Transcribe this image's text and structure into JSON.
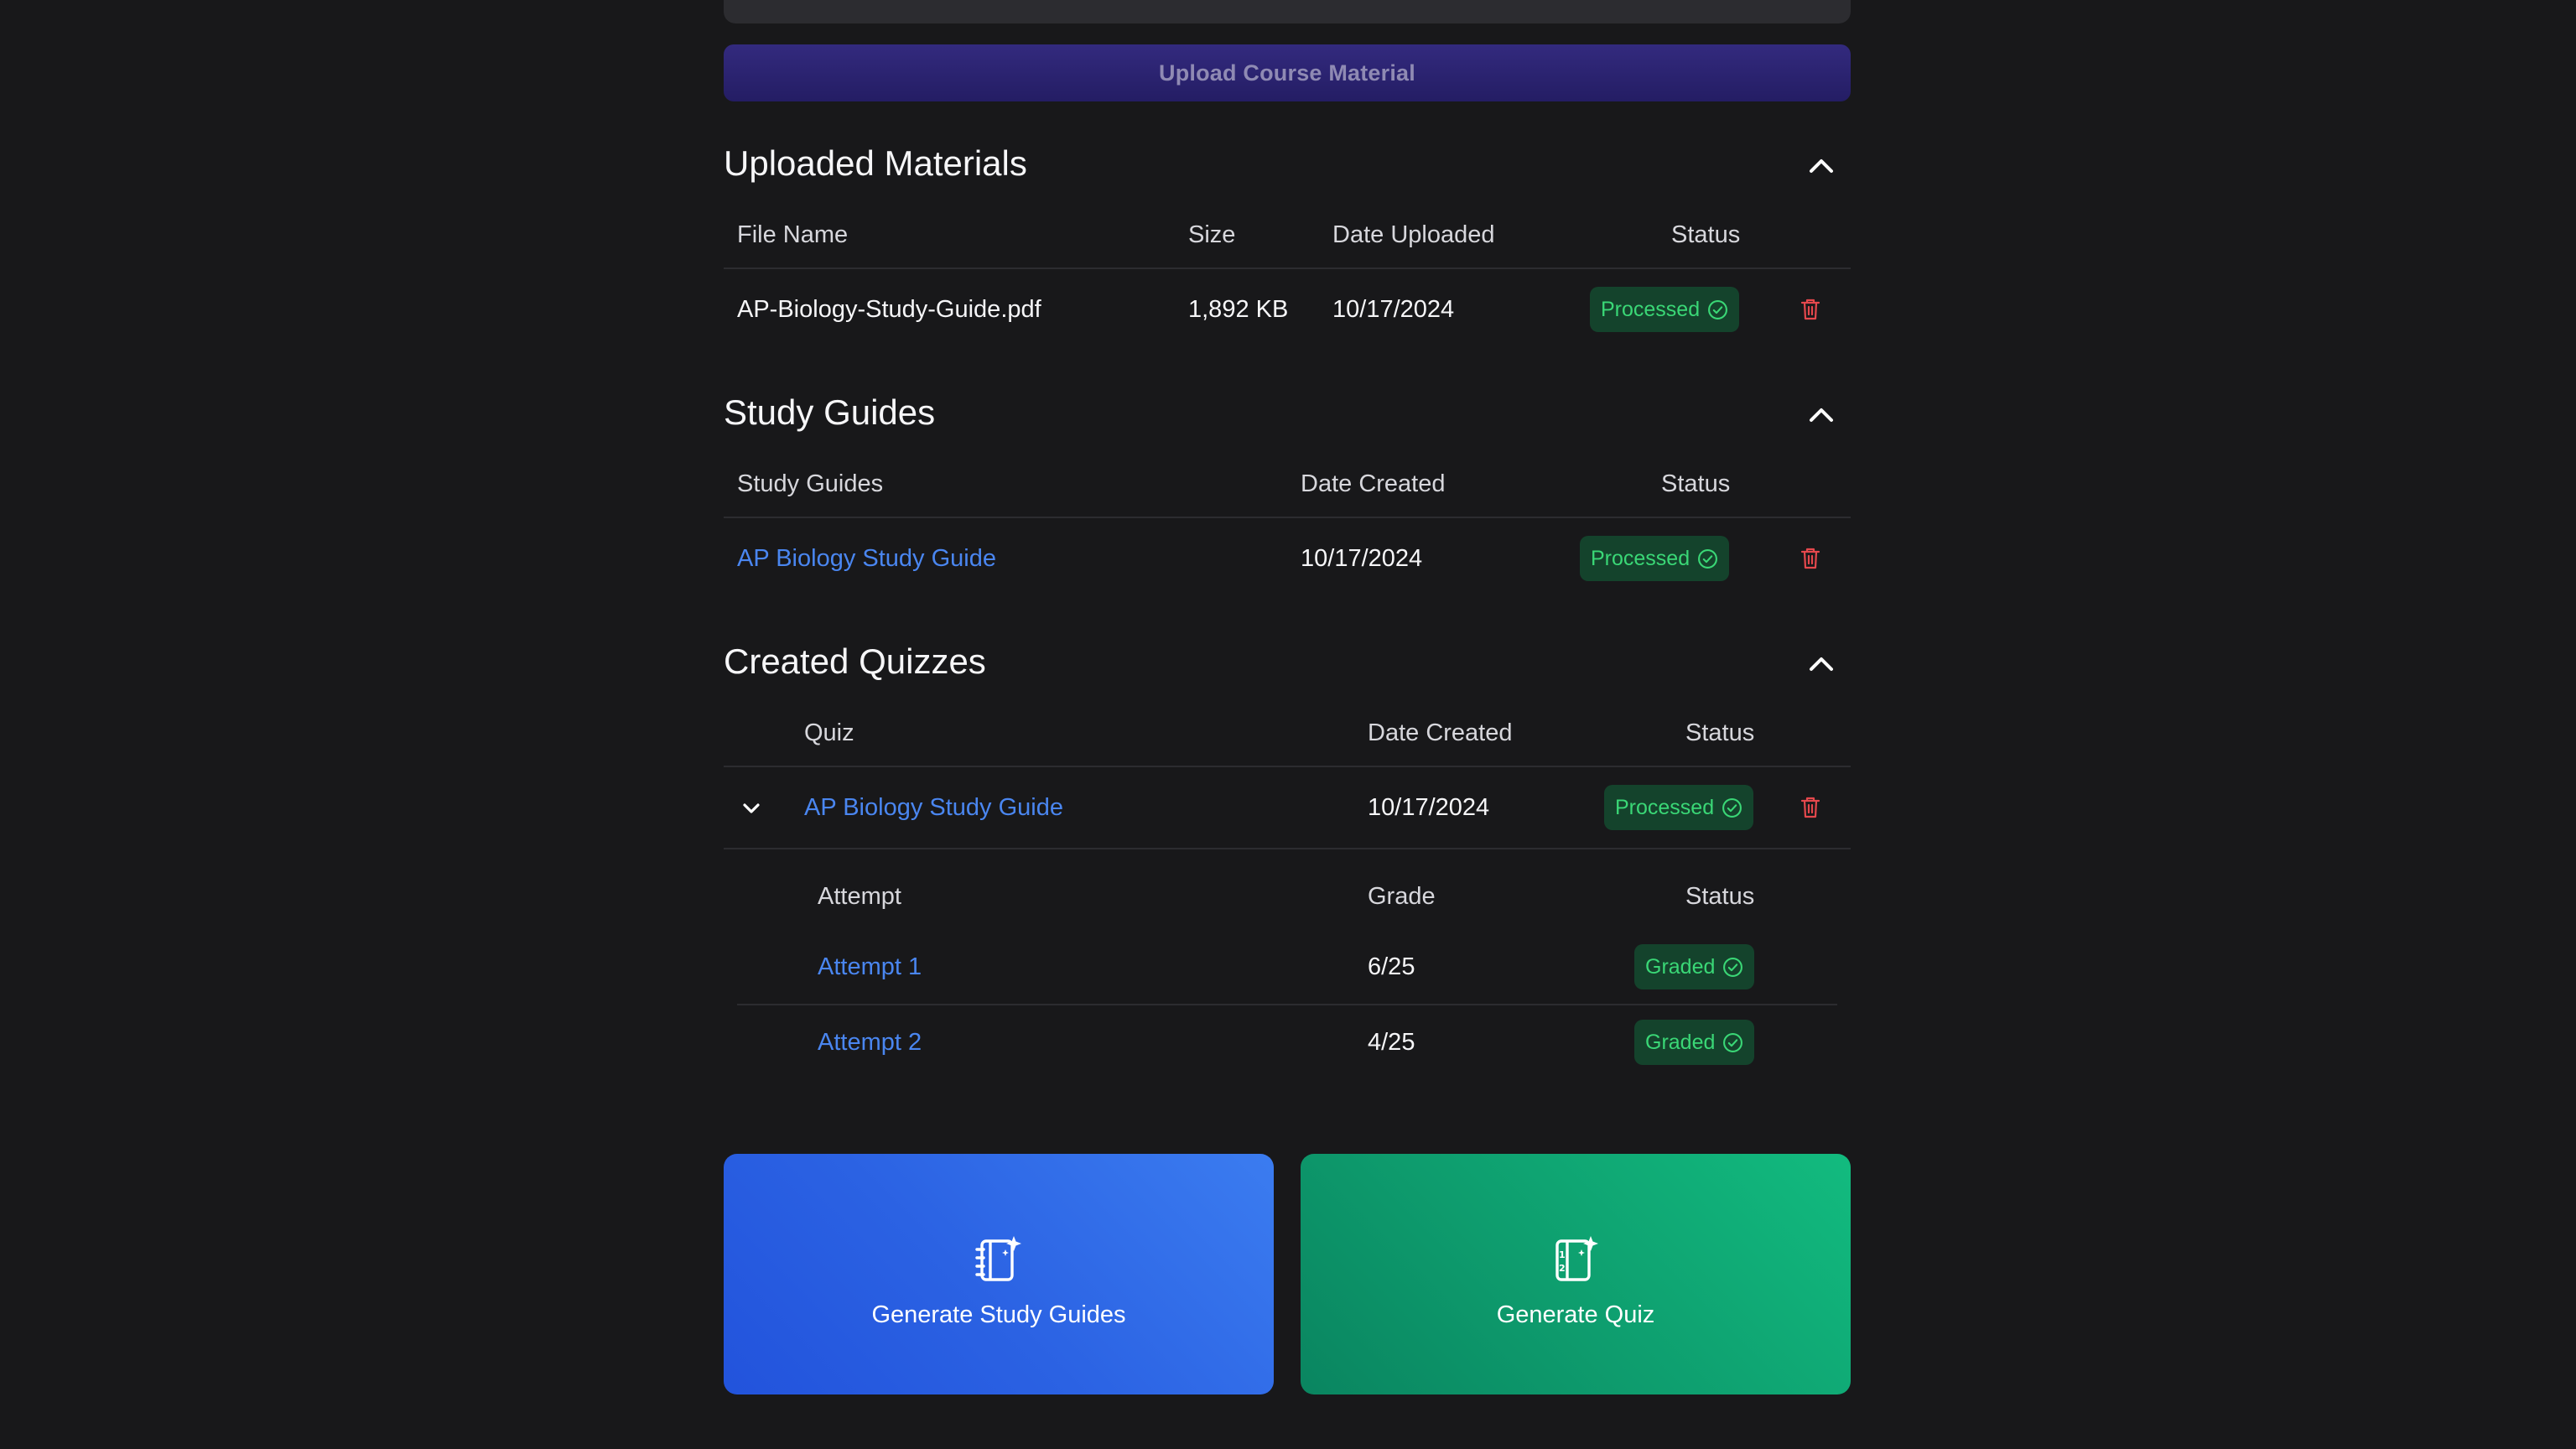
{
  "upload": {
    "button_label": "Upload Course Material"
  },
  "uploaded_materials": {
    "title": "Uploaded Materials",
    "headers": {
      "file_name": "File Name",
      "size": "Size",
      "date_uploaded": "Date Uploaded",
      "status": "Status"
    },
    "rows": [
      {
        "file_name": "AP-Biology-Study-Guide.pdf",
        "size": "1,892 KB",
        "date_uploaded": "10/17/2024",
        "status": "Processed"
      }
    ]
  },
  "study_guides": {
    "title": "Study Guides",
    "headers": {
      "name": "Study Guides",
      "date_created": "Date Created",
      "status": "Status"
    },
    "rows": [
      {
        "name": "AP Biology Study Guide",
        "date_created": "10/17/2024",
        "status": "Processed"
      }
    ]
  },
  "created_quizzes": {
    "title": "Created Quizzes",
    "headers": {
      "quiz": "Quiz",
      "date_created": "Date Created",
      "status": "Status"
    },
    "rows": [
      {
        "name": "AP Biology Study Guide",
        "date_created": "10/17/2024",
        "status": "Processed",
        "attempt_headers": {
          "attempt": "Attempt",
          "grade": "Grade",
          "status": "Status"
        },
        "attempts": [
          {
            "name": "Attempt 1",
            "grade": "6/25",
            "status": "Graded"
          },
          {
            "name": "Attempt 2",
            "grade": "4/25",
            "status": "Graded"
          }
        ]
      }
    ]
  },
  "actions": {
    "generate_study_guides": "Generate Study Guides",
    "generate_quiz": "Generate Quiz"
  },
  "colors": {
    "background": "#18181a",
    "link": "#4a86f0",
    "status_badge_bg": "#14432c",
    "status_badge_text": "#3ad776",
    "delete": "#e5484d",
    "upload_button": "#2b2370",
    "generate_study_guides_card": "#2b62e3",
    "generate_quiz_card": "#0e9d6e"
  },
  "icons": {
    "collapse": "chevron-up-icon",
    "expand": "chevron-down-icon",
    "status": "check-circle-icon",
    "delete": "trash-icon",
    "study_guide": "notebook-sparkle-icon",
    "quiz": "notebook-numbered-sparkle-icon"
  }
}
